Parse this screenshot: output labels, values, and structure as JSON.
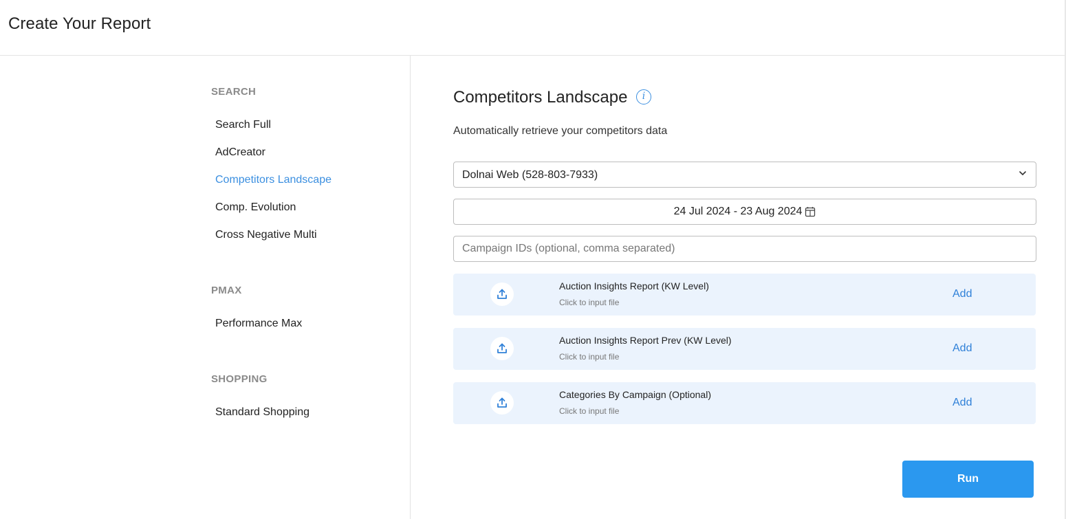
{
  "header": {
    "title": "Create Your Report"
  },
  "sidebar": {
    "sections": [
      {
        "label": "SEARCH",
        "items": [
          "Search Full",
          "AdCreator",
          "Competitors Landscape",
          "Comp. Evolution",
          "Cross Negative Multi"
        ]
      },
      {
        "label": "PMAX",
        "items": [
          "Performance Max"
        ]
      },
      {
        "label": "SHOPPING",
        "items": [
          "Standard Shopping"
        ]
      }
    ],
    "active_item": "Competitors Landscape"
  },
  "main": {
    "title": "Competitors Landscape",
    "info_icon": "info-icon",
    "subtitle": "Automatically retrieve your competitors data",
    "account_select": {
      "value": "Dolnai Web (528-803-7933)",
      "icon": "chevron-down-icon"
    },
    "date_range": {
      "value": "24 Jul 2024 - 23 Aug 2024",
      "icon": "calendar-icon"
    },
    "campaign_ids": {
      "value": "",
      "placeholder": "Campaign IDs (optional, comma separated)"
    },
    "uploads": [
      {
        "title": "Auction Insights Report (KW Level)",
        "hint": "Click to input file",
        "action": "Add",
        "icon": "upload-icon"
      },
      {
        "title": "Auction Insights Report Prev (KW Level)",
        "hint": "Click to input file",
        "action": "Add",
        "icon": "upload-icon"
      },
      {
        "title": "Categories By Campaign (Optional)",
        "hint": "Click to input file",
        "action": "Add",
        "icon": "upload-icon"
      }
    ],
    "run_label": "Run"
  },
  "colors": {
    "accent": "#3b8fe0",
    "run_button": "#2b98ef",
    "upload_row_bg": "#ebf3fd",
    "section_label": "#8a8a8a"
  }
}
